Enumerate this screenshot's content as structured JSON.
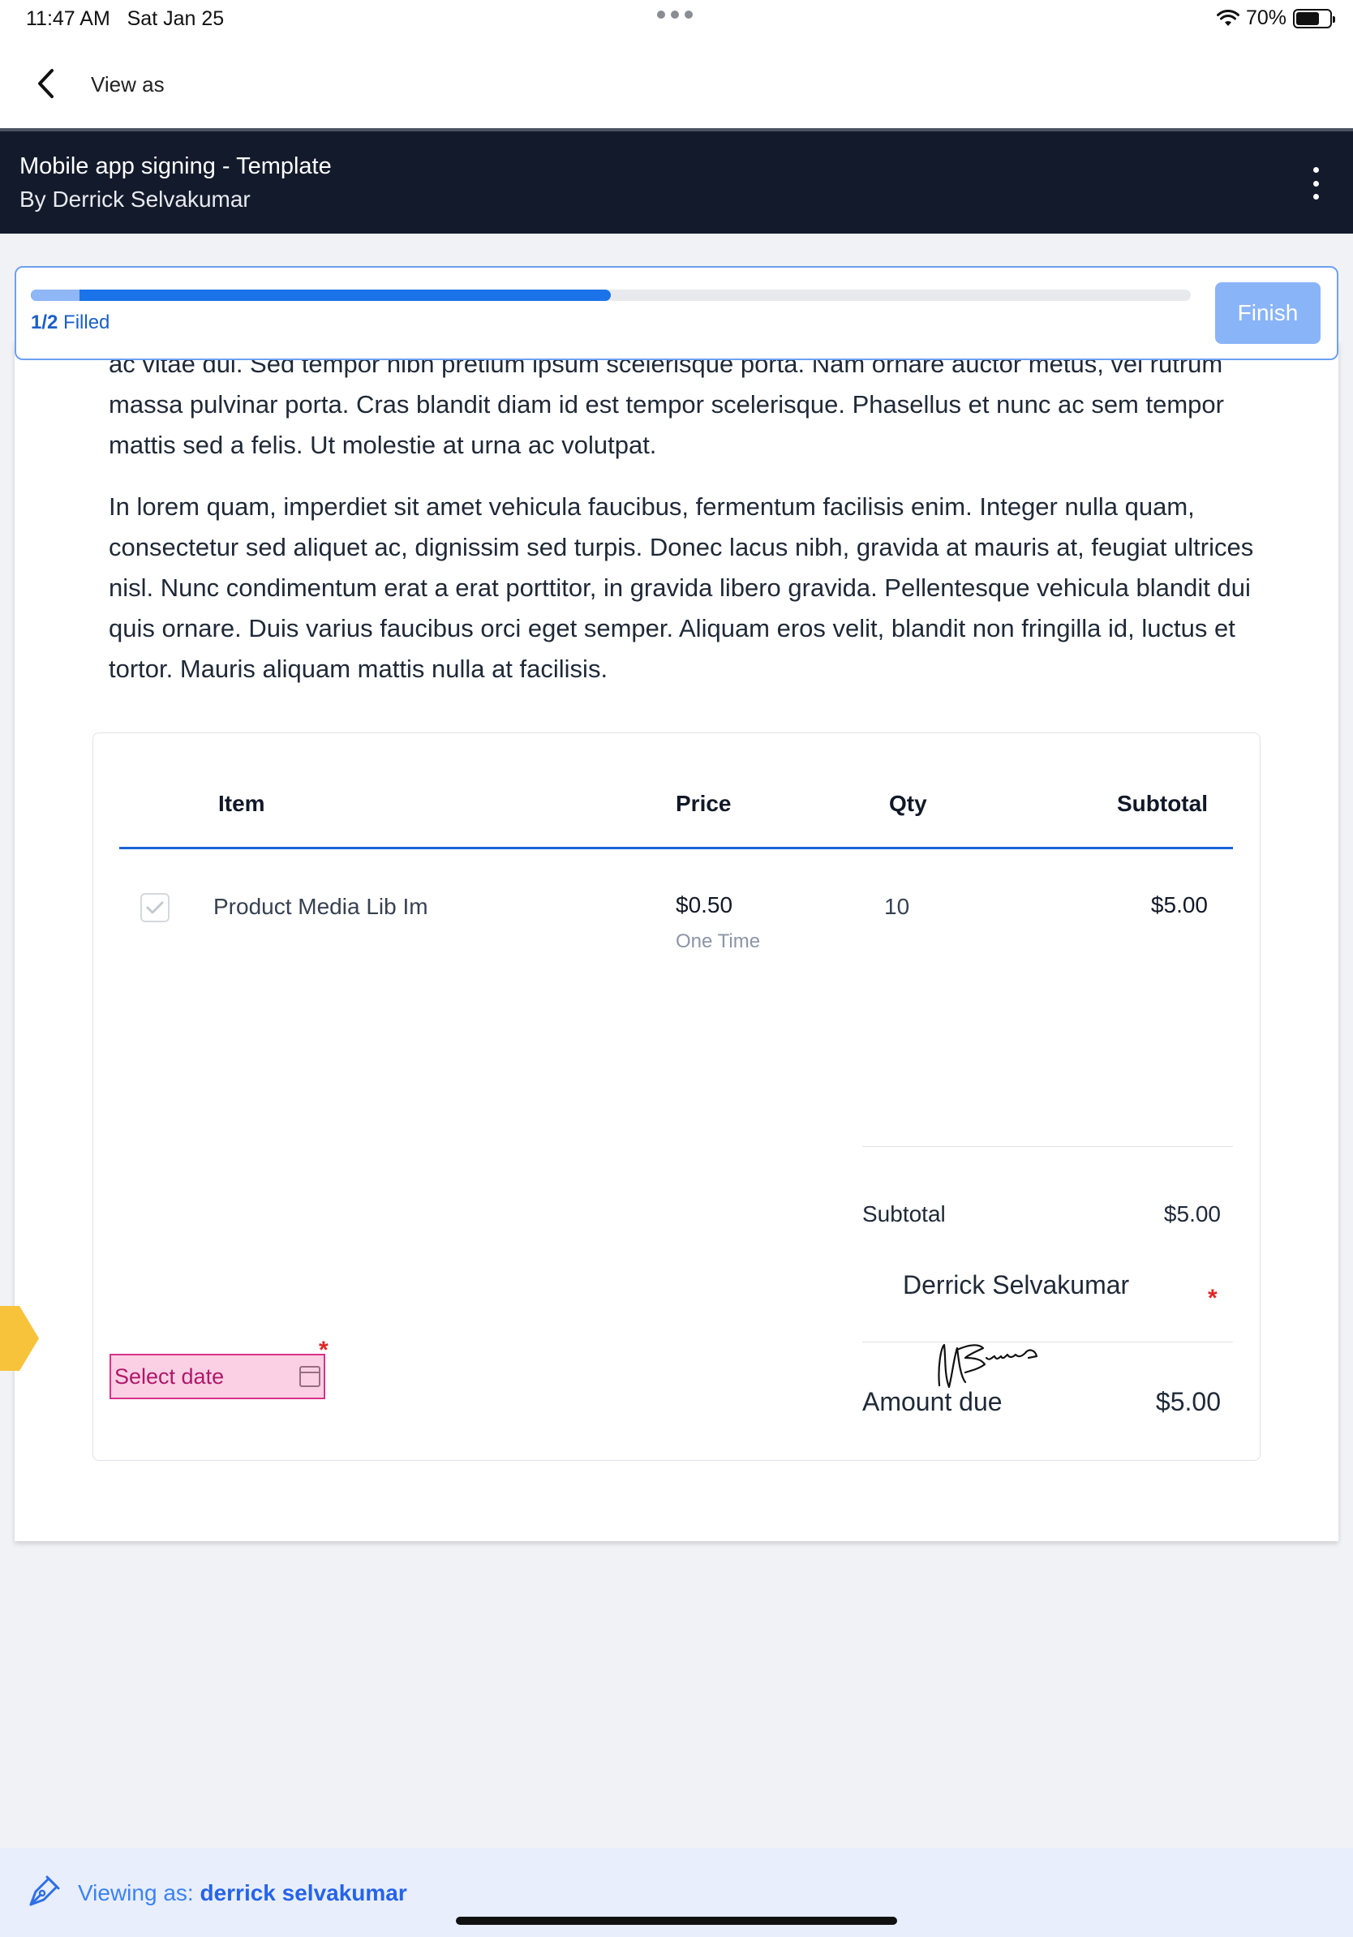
{
  "status_bar": {
    "time": "11:47 AM",
    "date": "Sat Jan 25",
    "battery": "70%",
    "battery_level": 0.7
  },
  "nav": {
    "back_icon": "chevron-left-icon",
    "title": "View as"
  },
  "header": {
    "title": "Mobile app signing - Template",
    "author": "By Derrick Selvakumar",
    "menu_icon": "kebab-menu-icon"
  },
  "progress": {
    "filled_count": "1/2",
    "filled_suffix": "Filled",
    "fraction": 0.5,
    "finish_label": "Finish"
  },
  "document": {
    "paragraph_1": "ac vitae dui. Sed tempor nibh pretium ipsum scelerisque porta. Nam ornare auctor metus, vel rutrum massa pulvinar porta. Cras blandit diam id est tempor scelerisque. Phasellus et nunc ac sem tempor mattis sed a felis. Ut molestie at urna ac volutpat.",
    "paragraph_2": "In lorem quam, imperdiet sit amet vehicula faucibus, fermentum facilisis enim. Integer nulla quam, consectetur sed aliquet ac, dignissim sed turpis. Donec lacus nibh, gravida at mauris at, feugiat ultrices nisl. Nunc condimentum erat a erat porttitor, in gravida libero gravida. Pellentesque vehicula blandit dui quis ornare. Duis varius faucibus orci eget semper. Aliquam eros velit, blandit non fringilla id, luctus et tortor. Mauris aliquam mattis nulla at facilisis."
  },
  "pricing_table": {
    "columns": [
      "Item",
      "Price",
      "Qty",
      "Subtotal"
    ],
    "rows": [
      {
        "item": "Product Media Lib Im",
        "price": "$0.50",
        "billing": "One Time",
        "qty": "10",
        "subtotal": "$5.00",
        "checked": true
      }
    ],
    "summary": {
      "subtotal_label": "Subtotal",
      "subtotal_value": "$5.00",
      "amount_due_label": "Amount due",
      "amount_due_value": "$5.00"
    }
  },
  "signature": {
    "signer_name": "Derrick Selvakumar",
    "required_mark": "*"
  },
  "date_field": {
    "placeholder": "Select date",
    "required_mark": "*"
  },
  "footer": {
    "prefix": "Viewing as:",
    "user": "derrick selvakumar",
    "icon": "pen-nib-icon"
  },
  "colors": {
    "accent": "#1a73e8",
    "header_bg": "#131a2b",
    "finish_button": "#8ab4f8",
    "date_field_bg": "#fbd0e4",
    "date_field_border": "#d6338a",
    "required": "#e02424",
    "side_tab": "#f6c33b"
  }
}
